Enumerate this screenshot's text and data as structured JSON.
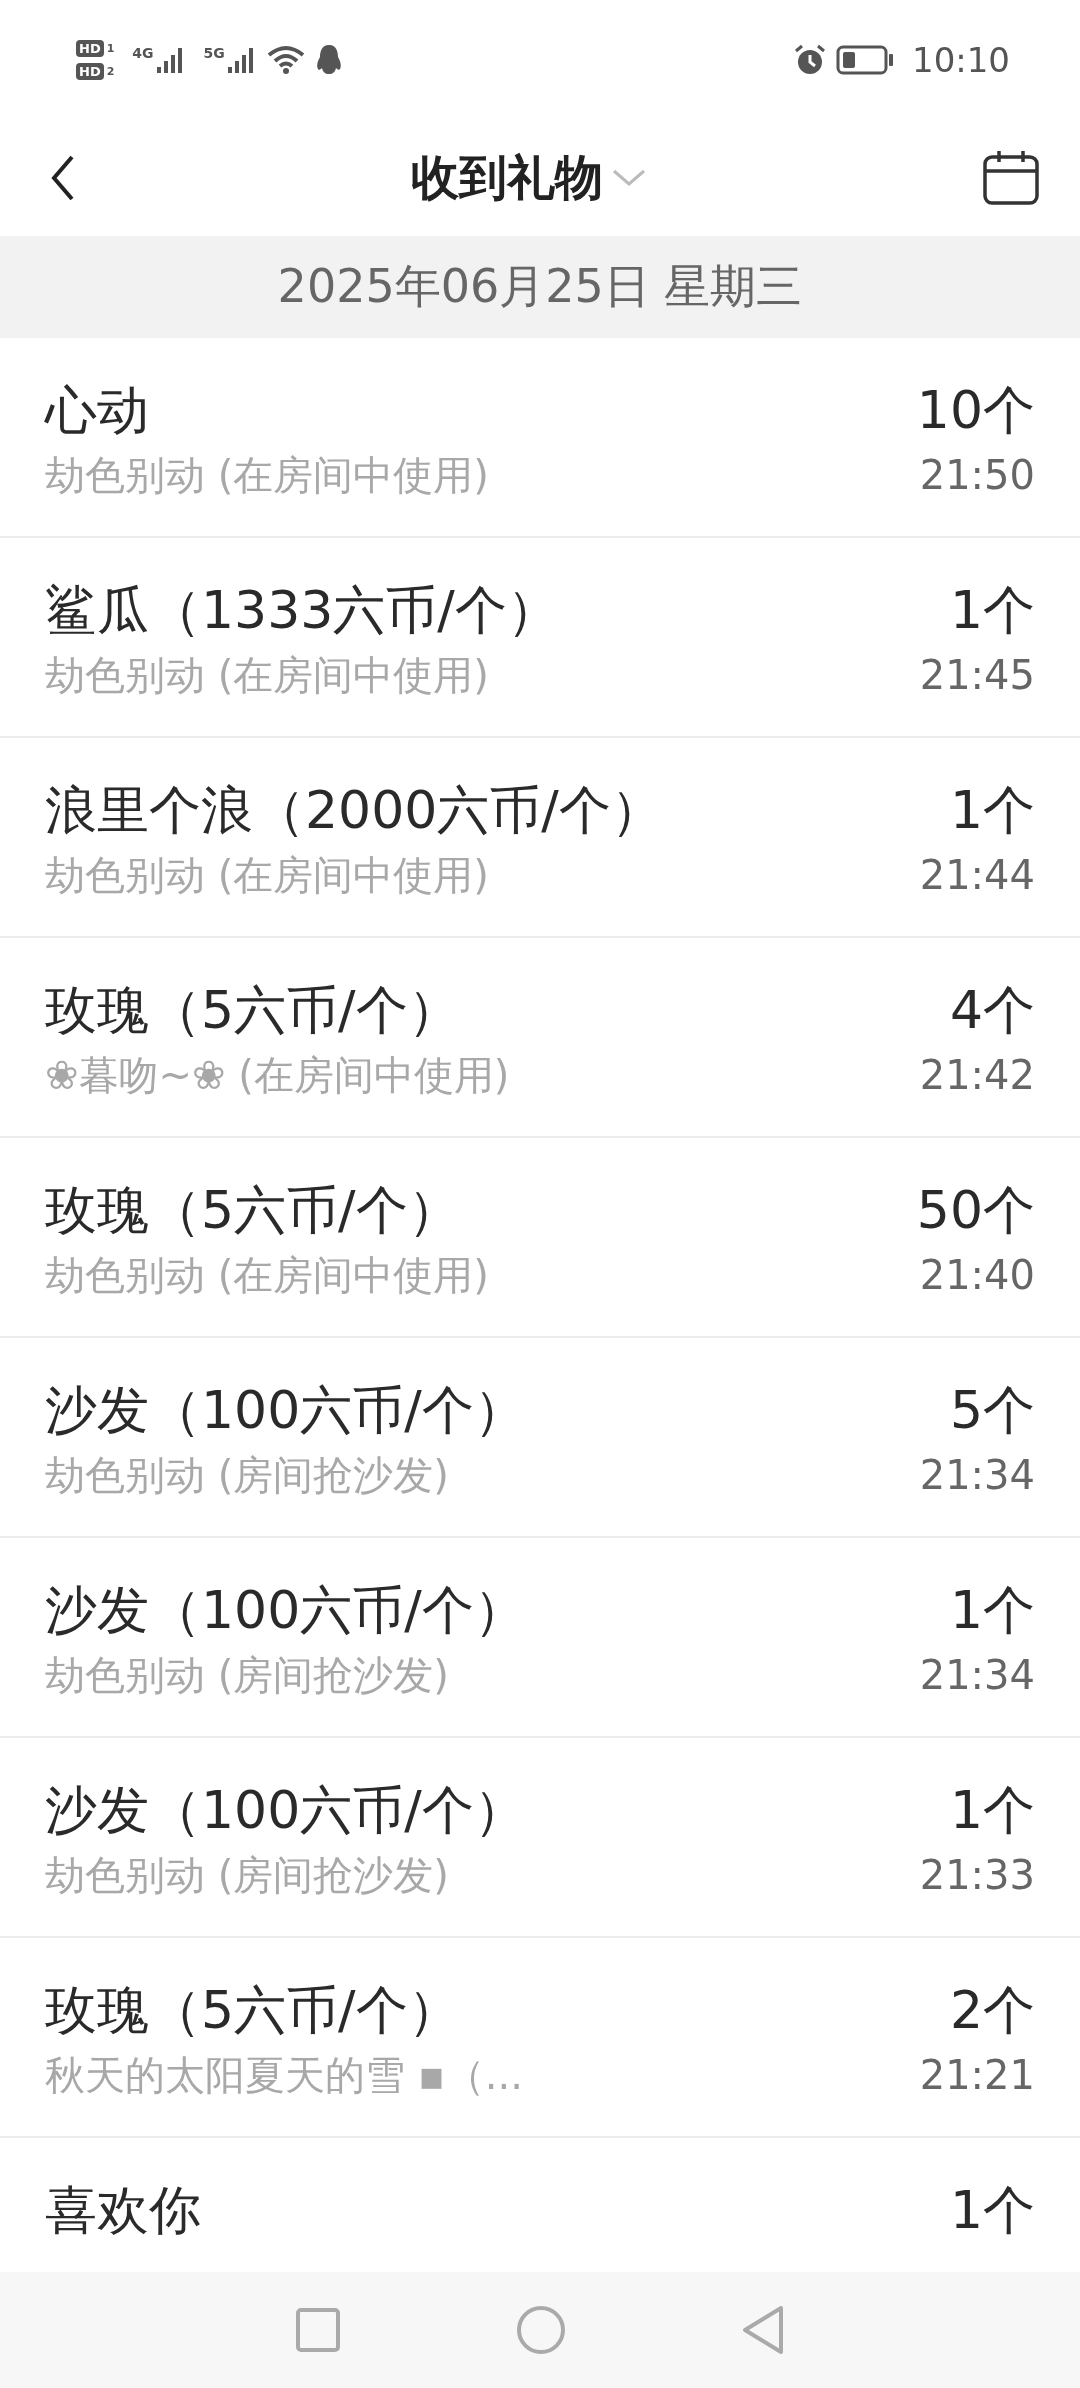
{
  "status_bar": {
    "sims": [
      {
        "badge": "HD",
        "slot": "1"
      },
      {
        "badge": "HD",
        "slot": "2"
      }
    ],
    "networks": [
      "4G",
      "5G"
    ],
    "time": "10:10"
  },
  "header": {
    "title": "收到礼物"
  },
  "date": "2025年06月25日 星期三",
  "gifts": [
    {
      "name": "心动",
      "source": "劫色别动 (在房间中使用)",
      "count": "10个",
      "time": "21:50"
    },
    {
      "name": "鲨瓜（1333六币/个）",
      "source": "劫色别动 (在房间中使用)",
      "count": "1个",
      "time": "21:45"
    },
    {
      "name": "浪里个浪（2000六币/个）",
      "source": "劫色别动 (在房间中使用)",
      "count": "1个",
      "time": "21:44"
    },
    {
      "name": "玫瑰（5六币/个）",
      "source": "❀暮吻~❀ (在房间中使用)",
      "count": "4个",
      "time": "21:42"
    },
    {
      "name": "玫瑰（5六币/个）",
      "source": "劫色别动 (在房间中使用)",
      "count": "50个",
      "time": "21:40"
    },
    {
      "name": "沙发（100六币/个）",
      "source": "劫色别动 (房间抢沙发)",
      "count": "5个",
      "time": "21:34"
    },
    {
      "name": "沙发（100六币/个）",
      "source": "劫色别动 (房间抢沙发)",
      "count": "1个",
      "time": "21:34"
    },
    {
      "name": "沙发（100六币/个）",
      "source": "劫色别动 (房间抢沙发)",
      "count": "1个",
      "time": "21:33"
    },
    {
      "name": "玫瑰（5六币/个）",
      "source": "秋天的太阳夏天的雪 ▪（...",
      "count": "2个",
      "time": "21:21"
    },
    {
      "name": "喜欢你",
      "count": "1个"
    }
  ]
}
